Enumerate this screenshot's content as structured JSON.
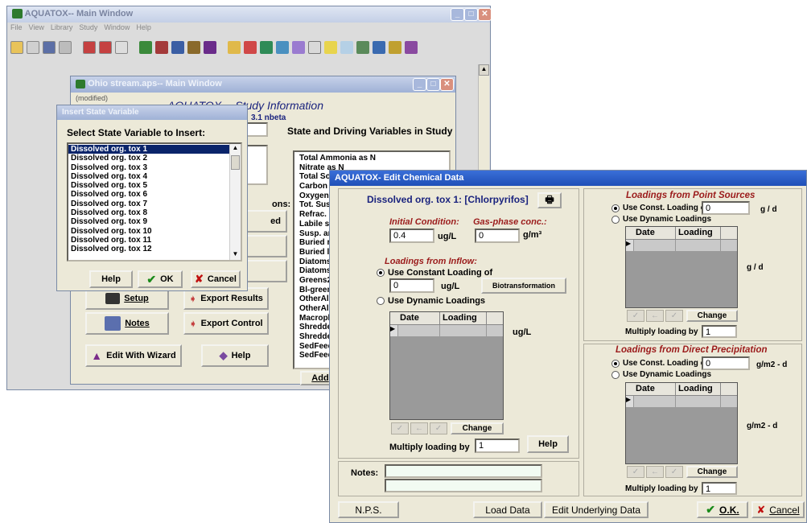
{
  "main_window": {
    "title": "AQUATOX-- Main Window",
    "menu": [
      "File",
      "View",
      "Library",
      "Study",
      "Window",
      "Help"
    ]
  },
  "study_window": {
    "title": "Ohio stream.aps-- Main Window",
    "modified": "(modified)",
    "heading": "AQUATOX -- Study Information",
    "version": "3.1 nbeta",
    "state_vars_label": "State and Driving Variables in Study",
    "state_vars": [
      "Total Ammonia as N",
      "Nitrate as N",
      "Total Soluble P",
      "Carbon dioxide",
      "Oxygen",
      "Tot. Susp. Solids",
      "Refrac. sed. detr",
      "Labile sed. detr",
      "Susp. and diss. detr",
      "Buried refr. detr",
      "Buried lab. detr",
      "Diatoms1:",
      "Diatoms2:",
      "Greens2:",
      "Bl-green1",
      "OtherAlg1",
      "OtherAlg2",
      "Macrophy",
      "Shredder1",
      "Shredder2",
      "SedFeeder",
      "SedFeeder"
    ],
    "options_label": "ons:",
    "advanced_label": "ed",
    "setup_label": "Setup",
    "export_results_label": "Export Results",
    "notes_label": "Notes",
    "export_control_label": "Export Control",
    "wizard_label": "Edit With Wizard",
    "help_label": "Help",
    "add_label": "Add"
  },
  "insert_dialog": {
    "title": "Insert State Variable",
    "heading": "Select State Variable to Insert:",
    "items": [
      "Dissolved org. tox 1",
      "Dissolved org. tox 2",
      "Dissolved org. tox 3",
      "Dissolved org. tox 4",
      "Dissolved org. tox 5",
      "Dissolved org. tox 6",
      "Dissolved org. tox 7",
      "Dissolved org. tox 8",
      "Dissolved org. tox 9",
      "Dissolved org. tox 10",
      "Dissolved org. tox 11",
      "Dissolved org. tox 12"
    ],
    "selected_index": 0,
    "help_label": "Help",
    "ok_label": "OK",
    "cancel_label": "Cancel"
  },
  "chem_dialog": {
    "title": "AQUATOX- Edit Chemical Data",
    "chem_name": "Dissolved org. tox 1: [Chlorpyrifos]",
    "initial_condition_label": "Initial Condition:",
    "initial_condition_value": "0.4",
    "initial_condition_unit": "ug/L",
    "gas_phase_label": "Gas-phase conc.:",
    "gas_phase_value": "0",
    "gas_phase_unit": "g/m³",
    "inflow_heading": "Loadings from Inflow:",
    "inflow_const_label": "Use Constant Loading of",
    "inflow_const_value": "0",
    "inflow_const_unit": "ug/L",
    "biotrans_label": "Biotransformation",
    "inflow_dynamic_label": "Use Dynamic Loadings",
    "inflow_grid_unit": "ug/L",
    "inflow_multiply_label": "Multiply loading by",
    "inflow_multiply_value": "1",
    "help_label": "Help",
    "notes_label": "Notes:",
    "point_heading": "Loadings from Point Sources",
    "point_const_label": "Use Const. Loading of",
    "point_const_value": "0",
    "point_unit": "g / d",
    "point_dynamic_label": "Use Dynamic Loadings",
    "point_grid_unit": "g / d",
    "point_multiply_label": "Multiply loading by",
    "point_multiply_value": "1",
    "precip_heading": "Loadings from Direct Precipitation",
    "precip_const_label": "Use Const. Loading of",
    "precip_const_value": "0",
    "precip_unit": "g/m2 - d",
    "precip_dynamic_label": "Use Dynamic Loadings",
    "precip_grid_unit": "g/m2 - d",
    "precip_multiply_label": "Multiply loading by",
    "precip_multiply_value": "1",
    "grid_col_date": "Date",
    "grid_col_loading": "Loading",
    "change_label": "Change",
    "nps_label": "N.P.S.",
    "load_data_label": "Load Data",
    "edit_underlying_label": "Edit Underlying Data",
    "ok_label": "O.K.",
    "cancel_label": "Cancel"
  },
  "colors": {
    "accent_red": "#9b1b1b",
    "accent_blue": "#1a237e",
    "selection": "#0a246a"
  }
}
